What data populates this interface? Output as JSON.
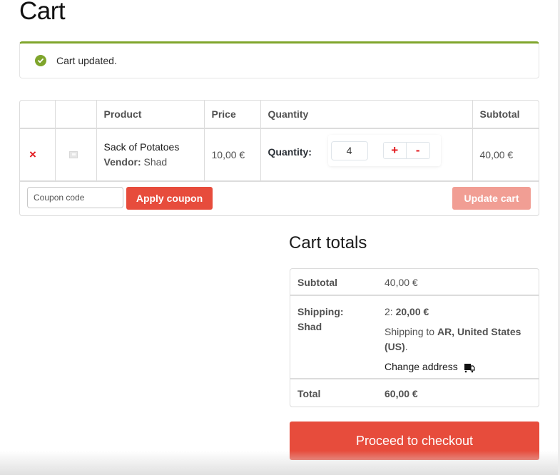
{
  "page": {
    "title": "Cart"
  },
  "notice": {
    "message": "Cart updated.",
    "icon": "check-circle-icon",
    "color": "#7fa52c"
  },
  "cart_table": {
    "headers": [
      "",
      "",
      "Product",
      "Price",
      "Quantity",
      "Subtotal"
    ],
    "rows": [
      {
        "remove_icon": "×",
        "product_name": "Sack of Potatoes",
        "vendor_label": "Vendor:",
        "vendor_name": "Shad",
        "price": "10,00 €",
        "quantity_label": "Quantity:",
        "quantity": "4",
        "increment": "+",
        "decrement": "-",
        "subtotal": "40,00 €"
      }
    ],
    "coupon_placeholder": "Coupon code",
    "apply_coupon_label": "Apply coupon",
    "update_cart_label": "Update cart"
  },
  "totals": {
    "title": "Cart totals",
    "subtotal_label": "Subtotal",
    "subtotal_value": "40,00 €",
    "shipping_label_line1": "Shipping:",
    "shipping_label_line2": "Shad",
    "shipping_method_prefix": "2: ",
    "shipping_method_price": "20,00 €",
    "shipping_to_prefix": "Shipping to ",
    "shipping_to_location": "AR, United States (US)",
    "shipping_to_suffix": ".",
    "change_address_label": "Change address",
    "total_label": "Total",
    "total_value": "60,00 €"
  },
  "checkout": {
    "label": "Proceed to checkout"
  },
  "colors": {
    "accent": "#e74c3c",
    "accent_disabled": "#f19e94",
    "success": "#7fa52c",
    "remove": "#e2171c"
  }
}
